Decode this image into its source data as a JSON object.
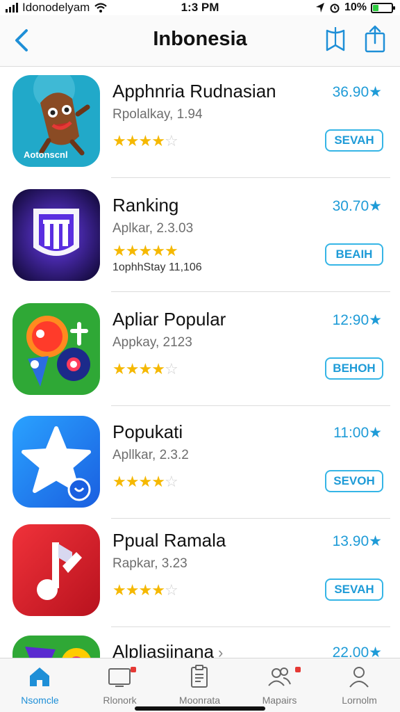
{
  "status_bar": {
    "carrier": "Idonodelyam",
    "time": "1:3 PM",
    "battery": "10%",
    "battery_level": 0.3
  },
  "nav": {
    "title": "Inbonesia",
    "back_icon": "chevron-left-icon",
    "actions": [
      "bookmark-icon",
      "share-icon"
    ]
  },
  "apps": [
    {
      "name": "Apphnria Rudnasian",
      "sub": "Rpolalkay, 1.94",
      "price": "36.90★",
      "button": "SEVAH",
      "rating": 4,
      "icon_label": "Aotonscnl",
      "icon": "character-icon",
      "color": "#21a9c9"
    },
    {
      "name": "Ranking",
      "sub": "Aplkar, 2.3.03",
      "price": "30.70★",
      "button": "BEAIH",
      "rating": 5,
      "extra": "1ophhStay 11,106",
      "icon": "shield-icon",
      "color": "#4a2bd1"
    },
    {
      "name": "Apliar Popular",
      "sub": "Appkay, 2123",
      "price": "12:90★",
      "button": "BEHOH",
      "rating": 4,
      "icon": "bubbles-icon",
      "color": "#2fa836"
    },
    {
      "name": "Popukati",
      "sub": "Apllkar, 2.3.2",
      "price": "11:00★",
      "button": "SEVOH",
      "rating": 4,
      "icon": "star-icon",
      "color": "#1e7cf0"
    },
    {
      "name": "Ppual Ramala",
      "sub": "Rapkar, 3.23",
      "price": "13.90★",
      "button": "SEVAH",
      "rating": 4,
      "icon": "music-note-icon",
      "color": "#dc1f2a"
    },
    {
      "name": "Alpliasiinana",
      "price": "22.00★",
      "icon": "triangle-art-icon",
      "color": "#2fa836"
    }
  ],
  "tabs": [
    {
      "label": "Nsomcle",
      "icon": "home-icon",
      "active": true
    },
    {
      "label": "Rlonork",
      "icon": "tv-icon",
      "badge": true
    },
    {
      "label": "Moonrata",
      "icon": "clipboard-icon"
    },
    {
      "label": "Mapairs",
      "icon": "people-icon",
      "badge": true
    },
    {
      "label": "Lornolm",
      "icon": "person-icon"
    }
  ],
  "colors": {
    "accent": "#1e9bd7",
    "star": "#f5b800"
  }
}
